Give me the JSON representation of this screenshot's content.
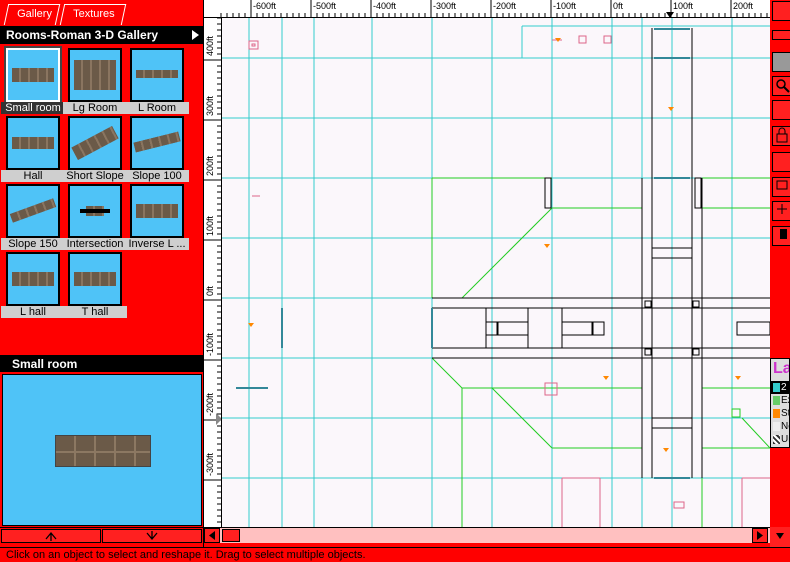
{
  "tabs": [
    {
      "label": "Gallery"
    },
    {
      "label": "Textures"
    }
  ],
  "gallery": {
    "title": "Rooms-Roman 3-D Gallery",
    "items": [
      {
        "label": "Small room",
        "selected": true
      },
      {
        "label": "Lg Room"
      },
      {
        "label": "L Room"
      },
      {
        "label": "Hall"
      },
      {
        "label": "Short Slope"
      },
      {
        "label": "Slope 100"
      },
      {
        "label": "Slope 150"
      },
      {
        "label": "Intersection"
      },
      {
        "label": "Inverse L ..."
      },
      {
        "label": "L hall"
      },
      {
        "label": "T hall"
      }
    ]
  },
  "preview": {
    "title": "Small room"
  },
  "ruler_top": {
    "labels": [
      "-600ft",
      "-500ft",
      "-400ft",
      "-300ft",
      "-200ft",
      "-100ft",
      "0ft",
      "100ft",
      "200ft"
    ]
  },
  "ruler_left": {
    "labels": [
      "400ft",
      "300ft",
      "200ft",
      "100ft",
      "0ft",
      "-100ft",
      "-200ft",
      "-300ft"
    ]
  },
  "layers": {
    "title": "La",
    "rows": [
      {
        "label": "2",
        "color": "#000000"
      },
      {
        "label": "Ex",
        "color": "#66cc66"
      },
      {
        "label": "St",
        "color": "#ff8800"
      },
      {
        "label": "Ne",
        "color": "#dddddd"
      },
      {
        "label": "Un",
        "color": "#888888"
      }
    ]
  },
  "status": {
    "text": "Click on an object to select and reshape it. Drag to select multiple objects."
  },
  "colors": {
    "panel": "#ff0000",
    "thumb_bg": "#4fc3f7",
    "grid": "#33cccc",
    "green_lines": "#22cc22",
    "drawing_bg": "#fbf7fb"
  }
}
